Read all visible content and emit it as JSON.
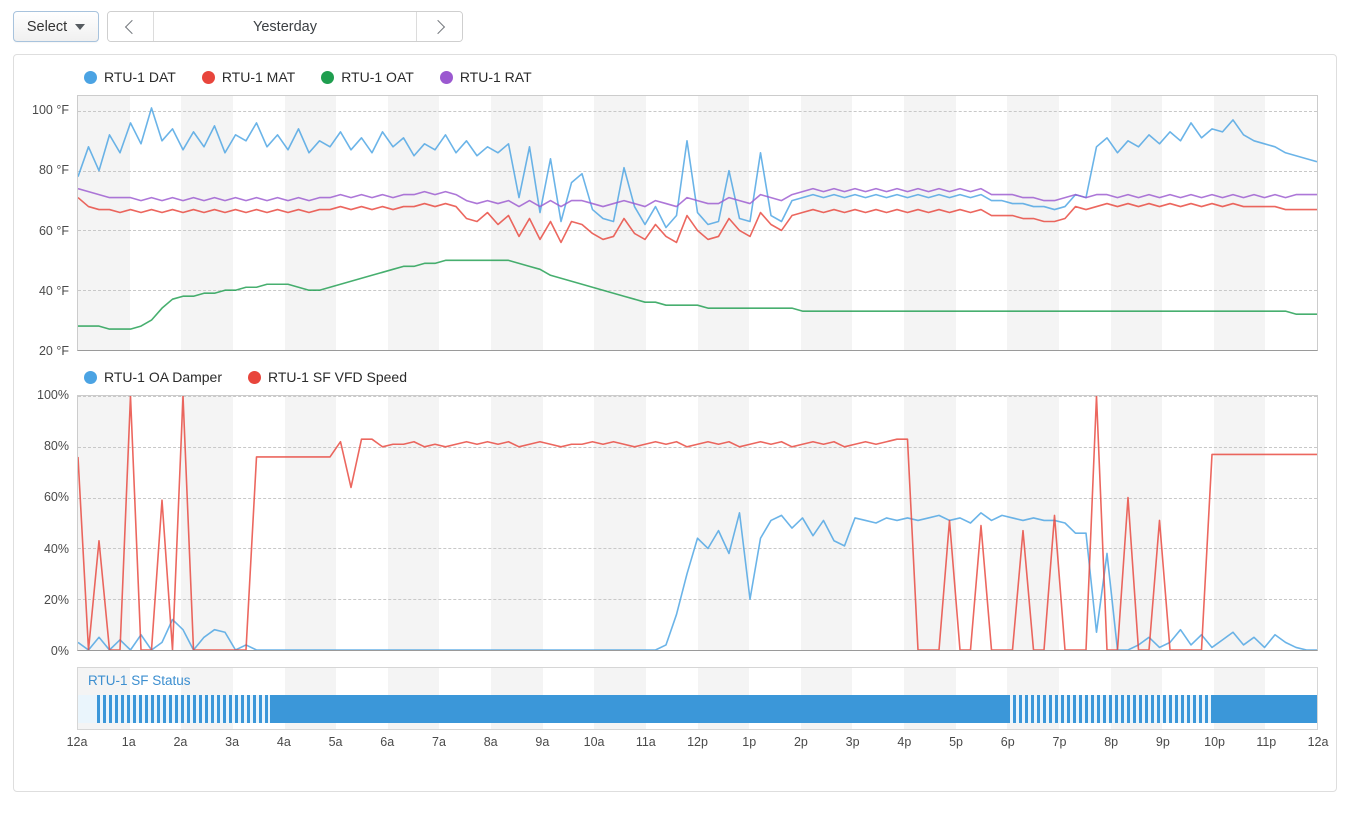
{
  "toolbar": {
    "select_label": "Select",
    "select_caret_icon": "chevron-down-icon",
    "prev_icon": "chevron-left-icon",
    "next_icon": "chevron-right-icon",
    "range_label": "Yesterday"
  },
  "colors": {
    "blue": "#4ba3e3",
    "red": "#e8453c",
    "green": "#1f9e4f",
    "purple": "#9b59d0",
    "line_blue": "#5ea9dd",
    "line_red": "#df6b60",
    "line_green": "#3fae78",
    "line_purple": "#a47de0",
    "status_blue": "#3b97d9",
    "status_label": "#3d8fd0",
    "band": "#f4f4f4",
    "grid": "#c8c8c8"
  },
  "chart_data": [
    {
      "type": "line",
      "title": "",
      "id": "temperatures",
      "xlabel": "",
      "ylabel": "",
      "ylim": [
        20,
        105
      ],
      "yticks": [
        "100 °F",
        "80 °F",
        "60 °F",
        "40 °F",
        "20 °F"
      ],
      "ytick_values": [
        100,
        80,
        60,
        40,
        20
      ],
      "grid": true,
      "legend_position": "top-left",
      "x": [
        0,
        0.25,
        0.5,
        0.75,
        1,
        1.25,
        1.5,
        1.75,
        2,
        2.25,
        2.5,
        2.75,
        3,
        3.25,
        3.5,
        3.75,
        4,
        4.25,
        4.5,
        4.75,
        5,
        5.25,
        5.5,
        5.75,
        6,
        6.25,
        6.5,
        6.75,
        7,
        7.25,
        7.5,
        7.75,
        8,
        8.25,
        8.5,
        8.75,
        9,
        9.25,
        9.5,
        9.75,
        10,
        10.25,
        10.5,
        10.75,
        11,
        11.25,
        11.5,
        11.75,
        12,
        12.25,
        12.5,
        12.75,
        13,
        13.25,
        13.5,
        13.75,
        14,
        14.25,
        14.5,
        14.75,
        15,
        15.25,
        15.5,
        15.75,
        16,
        16.25,
        16.5,
        16.75,
        17,
        17.25,
        17.5,
        17.75,
        18,
        18.25,
        18.5,
        18.75,
        19,
        19.25,
        19.5,
        19.75,
        20,
        20.25,
        20.5,
        20.75,
        21,
        21.25,
        21.5,
        21.75,
        22,
        22.25,
        22.5,
        22.75,
        23,
        23.25,
        23.5,
        23.75,
        24
      ],
      "series": [
        {
          "name": "RTU-1 DAT",
          "color": "#4ba3e3",
          "values": [
            78,
            88,
            80,
            92,
            86,
            96,
            89,
            101,
            90,
            94,
            87,
            93,
            88,
            95,
            86,
            92,
            90,
            96,
            88,
            92,
            87,
            94,
            86,
            90,
            88,
            93,
            87,
            91,
            86,
            93,
            88,
            91,
            85,
            89,
            87,
            92,
            86,
            90,
            85,
            88,
            86,
            89,
            71,
            88,
            66,
            84,
            63,
            76,
            79,
            67,
            64,
            63,
            81,
            68,
            62,
            68,
            61,
            65,
            90,
            66,
            62,
            63,
            80,
            64,
            63,
            86,
            65,
            63,
            70,
            71,
            72,
            71,
            72,
            71,
            72,
            71,
            72,
            71,
            72,
            71,
            72,
            71,
            72,
            71,
            72,
            71,
            72,
            70,
            70,
            69,
            69,
            68,
            68,
            67,
            68,
            72,
            71,
            88,
            91,
            86,
            90,
            88,
            92,
            89,
            93,
            90,
            96,
            91,
            94,
            93,
            97,
            92,
            90,
            89,
            88,
            86,
            85,
            84,
            83
          ]
        },
        {
          "name": "RTU-1 MAT",
          "color": "#e8453c",
          "values": [
            71,
            68,
            67,
            67,
            66,
            67,
            66,
            67,
            66,
            67,
            66,
            67,
            66,
            67,
            66,
            67,
            66,
            67,
            66,
            67,
            66,
            67,
            66,
            67,
            67,
            68,
            67,
            68,
            67,
            68,
            67,
            68,
            68,
            69,
            68,
            69,
            68,
            64,
            63,
            66,
            62,
            65,
            58,
            64,
            57,
            63,
            56,
            63,
            62,
            59,
            57,
            58,
            64,
            59,
            57,
            62,
            58,
            56,
            65,
            60,
            57,
            58,
            64,
            60,
            58,
            66,
            62,
            60,
            65,
            66,
            67,
            66,
            67,
            66,
            67,
            66,
            67,
            66,
            67,
            66,
            67,
            66,
            67,
            66,
            67,
            66,
            67,
            65,
            65,
            65,
            64,
            64,
            63,
            63,
            64,
            68,
            67,
            68,
            69,
            68,
            69,
            68,
            69,
            68,
            69,
            68,
            69,
            68,
            69,
            68,
            69,
            68,
            68,
            68,
            68,
            67,
            67,
            67,
            67
          ]
        },
        {
          "name": "RTU-1 OAT",
          "color": "#1f9e4f",
          "values": [
            28,
            28,
            28,
            27,
            27,
            27,
            28,
            30,
            34,
            37,
            38,
            38,
            39,
            39,
            40,
            40,
            41,
            41,
            42,
            42,
            42,
            41,
            40,
            40,
            41,
            42,
            43,
            44,
            45,
            46,
            47,
            48,
            48,
            49,
            49,
            50,
            50,
            50,
            50,
            50,
            50,
            50,
            49,
            48,
            47,
            45,
            44,
            43,
            42,
            41,
            40,
            39,
            38,
            37,
            36,
            36,
            35,
            35,
            35,
            35,
            34,
            34,
            34,
            34,
            34,
            34,
            34,
            34,
            34,
            33,
            33,
            33,
            33,
            33,
            33,
            33,
            33,
            33,
            33,
            33,
            33,
            33,
            33,
            33,
            33,
            33,
            33,
            33,
            33,
            33,
            33,
            33,
            33,
            33,
            33,
            33,
            33,
            33,
            33,
            33,
            33,
            33,
            33,
            33,
            33,
            33,
            33,
            33,
            33,
            33,
            33,
            33,
            33,
            33,
            33,
            33,
            32,
            32,
            32
          ]
        },
        {
          "name": "RTU-1 RAT",
          "color": "#9b59d0",
          "values": [
            74,
            73,
            72,
            71,
            71,
            71,
            70,
            71,
            70,
            71,
            70,
            71,
            70,
            71,
            70,
            71,
            70,
            71,
            70,
            71,
            70,
            71,
            70,
            71,
            71,
            72,
            71,
            72,
            71,
            72,
            71,
            72,
            72,
            73,
            72,
            73,
            72,
            70,
            69,
            70,
            69,
            70,
            68,
            70,
            68,
            70,
            68,
            70,
            70,
            69,
            68,
            69,
            70,
            69,
            68,
            70,
            69,
            68,
            71,
            70,
            69,
            69,
            71,
            70,
            69,
            72,
            71,
            70,
            72,
            73,
            74,
            73,
            74,
            73,
            74,
            73,
            74,
            73,
            74,
            73,
            74,
            73,
            74,
            73,
            74,
            73,
            74,
            72,
            72,
            72,
            71,
            71,
            70,
            70,
            71,
            72,
            71,
            72,
            72,
            71,
            72,
            71,
            72,
            71,
            72,
            71,
            72,
            71,
            72,
            71,
            72,
            71,
            72,
            71,
            72,
            71,
            72,
            72,
            72
          ]
        }
      ]
    },
    {
      "type": "line",
      "id": "damper-vfd",
      "title": "",
      "xlabel": "",
      "ylabel": "",
      "ylim": [
        0,
        100
      ],
      "yticks": [
        "100%",
        "80%",
        "60%",
        "40%",
        "20%",
        "0%"
      ],
      "ytick_values": [
        100,
        80,
        60,
        40,
        20,
        0
      ],
      "grid": true,
      "legend_position": "top-left",
      "series": [
        {
          "name": "RTU-1 OA Damper",
          "color": "#4ba3e3",
          "values": [
            3,
            0,
            5,
            0,
            4,
            0,
            6,
            0,
            3,
            12,
            8,
            0,
            5,
            8,
            7,
            0,
            2,
            0,
            0,
            0,
            0,
            0,
            0,
            0,
            0,
            0,
            0,
            0,
            0,
            0,
            0,
            0,
            0,
            0,
            0,
            0,
            0,
            0,
            0,
            0,
            0,
            0,
            0,
            0,
            0,
            0,
            0,
            0,
            0,
            0,
            0,
            0,
            0,
            0,
            0,
            0,
            2,
            14,
            30,
            44,
            40,
            47,
            38,
            54,
            20,
            44,
            51,
            53,
            48,
            52,
            45,
            51,
            43,
            41,
            52,
            51,
            50,
            52,
            51,
            52,
            51,
            52,
            53,
            51,
            52,
            50,
            54,
            51,
            53,
            52,
            51,
            52,
            51,
            51,
            50,
            46,
            46,
            7,
            38,
            0,
            0,
            2,
            5,
            1,
            3,
            8,
            2,
            6,
            1,
            4,
            7,
            2,
            5,
            1,
            6,
            3,
            1,
            0,
            0
          ]
        },
        {
          "name": "RTU-1 SF VFD Speed",
          "color": "#e8453c",
          "values": [
            76,
            0,
            43,
            0,
            0,
            100,
            0,
            0,
            59,
            0,
            100,
            0,
            0,
            0,
            0,
            0,
            0,
            76,
            76,
            76,
            76,
            76,
            76,
            76,
            76,
            82,
            64,
            83,
            83,
            80,
            81,
            81,
            82,
            80,
            81,
            80,
            81,
            82,
            81,
            82,
            81,
            82,
            80,
            81,
            82,
            81,
            80,
            81,
            81,
            82,
            81,
            82,
            81,
            80,
            81,
            82,
            81,
            82,
            80,
            81,
            82,
            81,
            82,
            80,
            81,
            82,
            81,
            82,
            80,
            81,
            82,
            81,
            82,
            80,
            81,
            82,
            81,
            82,
            83,
            83,
            0,
            0,
            0,
            51,
            0,
            0,
            49,
            0,
            0,
            0,
            47,
            0,
            0,
            53,
            0,
            0,
            0,
            100,
            0,
            0,
            60,
            0,
            0,
            51,
            0,
            0,
            0,
            0,
            77,
            77,
            77,
            77,
            77,
            77,
            77,
            77,
            77,
            77,
            77
          ]
        }
      ]
    },
    {
      "type": "status",
      "id": "sf-status",
      "title": "RTU-1 SF Status",
      "color": "#3b97d9",
      "segments": [
        {
          "start_pct": 0.0,
          "end_pct": 1.5,
          "state": "off"
        },
        {
          "start_pct": 1.5,
          "end_pct": 15.5,
          "state": "cycling"
        },
        {
          "start_pct": 15.5,
          "end_pct": 75.0,
          "state": "on"
        },
        {
          "start_pct": 75.0,
          "end_pct": 91.5,
          "state": "cycling"
        },
        {
          "start_pct": 91.5,
          "end_pct": 100.0,
          "state": "on"
        }
      ]
    }
  ],
  "x_axis": {
    "ticks": [
      "12a",
      "1a",
      "2a",
      "3a",
      "4a",
      "5a",
      "6a",
      "7a",
      "8a",
      "9a",
      "10a",
      "11a",
      "12p",
      "1p",
      "2p",
      "3p",
      "4p",
      "5p",
      "6p",
      "7p",
      "8p",
      "9p",
      "10p",
      "11p",
      "12a"
    ]
  },
  "charts_meta": [
    {
      "legend": [
        {
          "label": "RTU-1 DAT",
          "color": "#4ba3e3"
        },
        {
          "label": "RTU-1 MAT",
          "color": "#e8453c"
        },
        {
          "label": "RTU-1 OAT",
          "color": "#1f9e4f"
        },
        {
          "label": "RTU-1 RAT",
          "color": "#9b59d0"
        }
      ]
    },
    {
      "legend": [
        {
          "label": "RTU-1 OA Damper",
          "color": "#4ba3e3"
        },
        {
          "label": "RTU-1 SF VFD Speed",
          "color": "#e8453c"
        }
      ]
    }
  ]
}
